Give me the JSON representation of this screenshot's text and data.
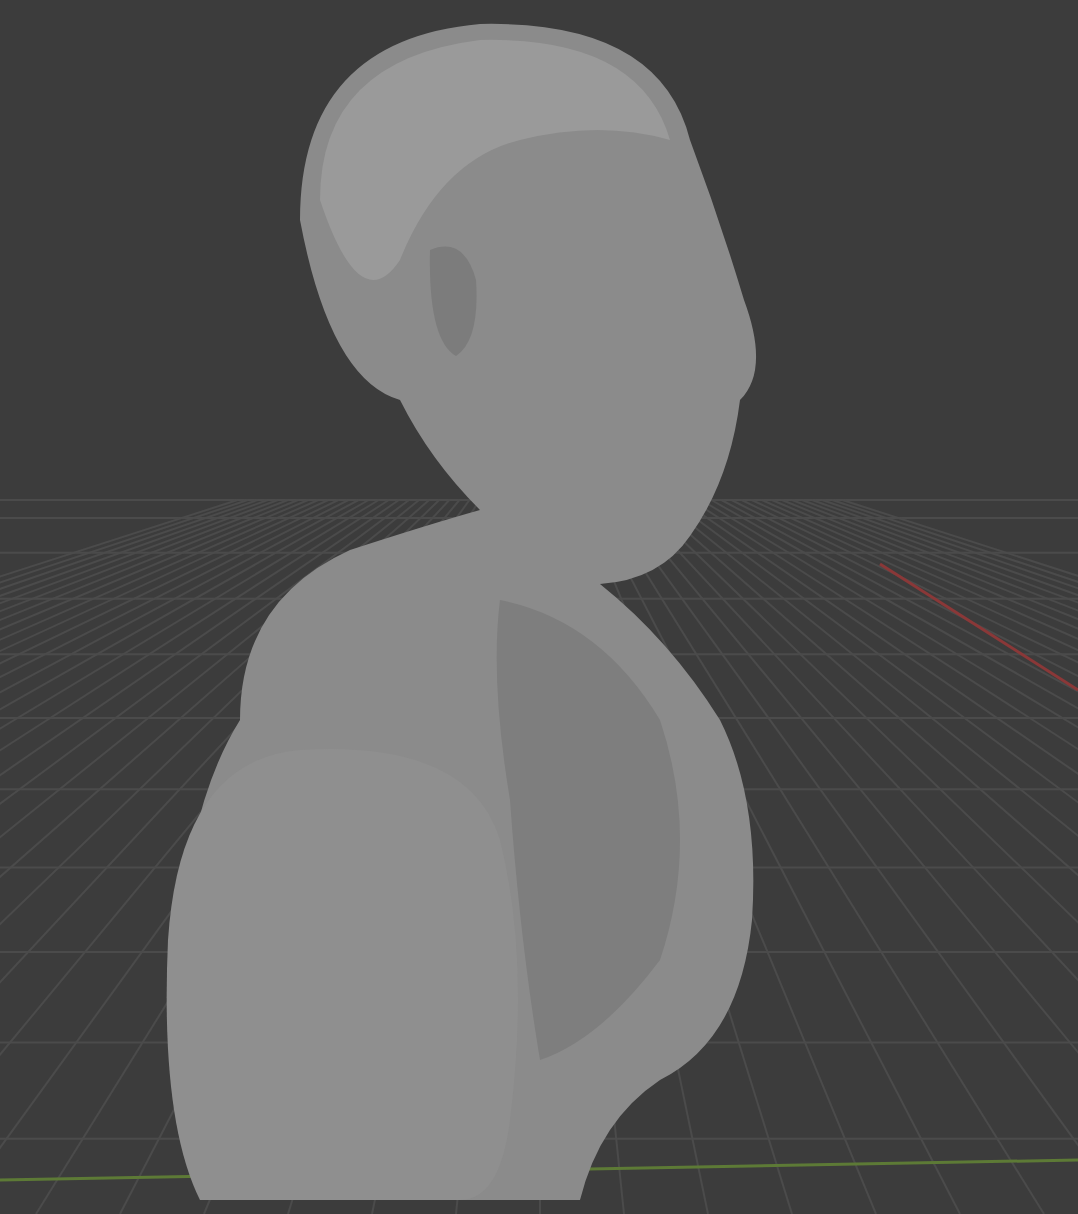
{
  "viewport": {
    "kind": "viewport",
    "object": {
      "kind": "bust"
    }
  }
}
